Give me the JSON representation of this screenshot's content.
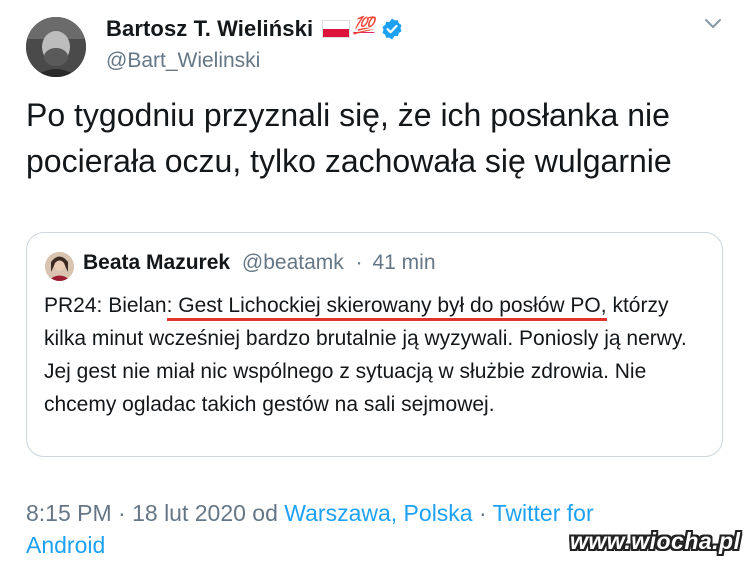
{
  "author": {
    "display_name": "Bartosz T. Wieliński",
    "handle": "@Bart_Wielinski",
    "badge_emoji": "💯"
  },
  "tweet": {
    "text": "Po tygodniu przyznali się, że ich posłanka nie pocierała oczu, tylko zachowała się wulgarnie"
  },
  "quoted_tweet": {
    "author_name": "Beata Mazurek",
    "handle": "@beatamk",
    "separator": "·",
    "age": "41 min",
    "text_prefix": "PR24: Bielan",
    "text_underlined": ": Gest Lichockiej skierowany był do posłów PO,",
    "text_rest": " którzy kilka minut wcześniej bardzo brutalnie ją wyzywali. Poniosly ją nerwy. Jej gest nie miał nic wspólnego z sytuacją w służbie zdrowia. Nie chcemy ogladac takich gestów na sali sejmowej."
  },
  "footer": {
    "time_date": "8:15 PM · 18 lut 2020 od",
    "location": "Warszawa, Polska",
    "separator": "·",
    "source": "Twitter for Android"
  },
  "watermark": "www.wiocha.pl",
  "colors": {
    "link": "#1da1f2",
    "muted": "#657786",
    "underline": "#e0332d"
  }
}
